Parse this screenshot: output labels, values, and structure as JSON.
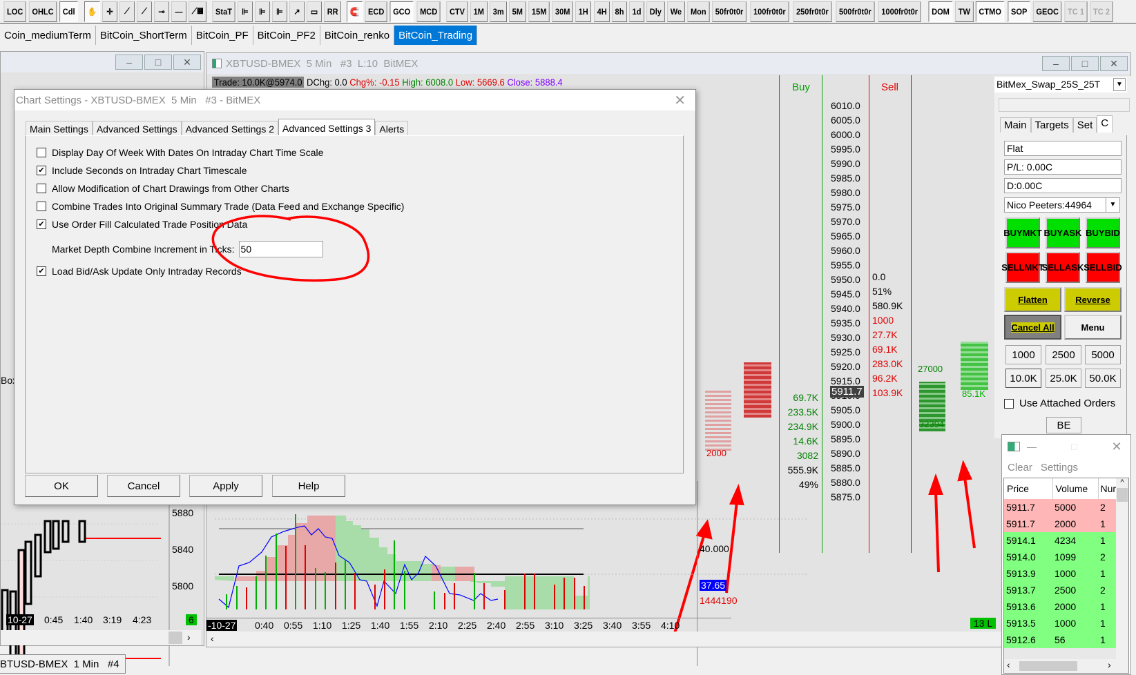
{
  "toolbar": {
    "buttons": [
      "LOC",
      "OHLC",
      "Cdl",
      "hand-tool",
      "crosshair",
      "line",
      "ray",
      "horizontal-ray",
      "horizontal-line",
      "calculator-line",
      "StaT",
      "fib-retracement",
      "fib-extension",
      "fib-time",
      "arrow",
      "rectangle",
      "RR",
      "magnet",
      "ECD",
      "GCO",
      "MCD",
      "CTV",
      "1M",
      "3m",
      "5M",
      "15M",
      "30M",
      "1H",
      "4H",
      "8h",
      "1d",
      "Dly",
      "We",
      "Mon",
      "50fr0t0r",
      "100fr0t0r",
      "250fr0t0r",
      "500fr0t0r",
      "1000fr0t0r",
      "DOM",
      "TW",
      "CTMO",
      "SOP",
      "GEOC",
      "TC 1",
      "TC 2"
    ]
  },
  "chartbook_tabs": [
    "Coin_mediumTerm",
    "BitCoin_ShortTerm",
    "BitCoin_PF",
    "BitCoin_PF2",
    "BitCoin_renko",
    "BitCoin_Trading"
  ],
  "main_chart": {
    "title": "XBTUSD-BMEX  5 Min   #3  L:10  BitMEX",
    "trade": "Trade: 10.0K@5974.0",
    "dchg": "DChg: 0.0",
    "chg": "Chg%: -0.15",
    "high": "High: 6008.0",
    "low": "Low: 5669.6",
    "close": "Close: 5888.4",
    "buy_header": "Buy",
    "sell_header": "Sell",
    "prices": [
      "6010.0",
      "6005.0",
      "6000.0",
      "5995.0",
      "5990.0",
      "5985.0",
      "5980.0",
      "5975.0",
      "5970.0",
      "5965.0",
      "5960.0",
      "5955.0",
      "5950.0",
      "5945.0",
      "5940.0",
      "5935.0",
      "5930.0",
      "5925.0",
      "5920.0",
      "5915.0",
      "5910.0",
      "5905.0",
      "5900.0",
      "5895.0",
      "5890.0",
      "5885.0",
      "5880.0",
      "5875.0"
    ],
    "current_price": "5911.7",
    "sell_stats": [
      {
        "text": "0.0",
        "color": "#000000"
      },
      {
        "text": "51%",
        "color": "#000000"
      },
      {
        "text": "580.9K",
        "color": "#000000"
      },
      {
        "text": "1000",
        "color": "#e00000"
      },
      {
        "text": "27.7K",
        "color": "#e00000"
      },
      {
        "text": "69.1K",
        "color": "#e00000"
      },
      {
        "text": "283.0K",
        "color": "#e00000"
      },
      {
        "text": "96.2K",
        "color": "#e00000"
      },
      {
        "text": "103.9K",
        "color": "#e00000"
      }
    ],
    "buy_stats": [
      {
        "text": "69.7K",
        "color": "#008000"
      },
      {
        "text": "233.5K",
        "color": "#008000"
      },
      {
        "text": "234.9K",
        "color": "#008000"
      },
      {
        "text": "14.6K",
        "color": "#008000"
      },
      {
        "text": "3082",
        "color": "#008000"
      },
      {
        "text": "555.9K",
        "color": "#000000"
      },
      {
        "text": "49%",
        "color": "#000000"
      }
    ],
    "cluster_labels": {
      "red_bottom": "2000",
      "green_bottom": "32394",
      "green_left_top": "27000",
      "green_right_bottom": "85.1K"
    },
    "indicator_axis": "40.000",
    "indicator_value": "37.65",
    "volume_value": "1444190",
    "time_labels": [
      "-10-27",
      "0:40",
      "0:55",
      "1:10",
      "1:25",
      "1:40",
      "1:55",
      "2:10",
      "2:25",
      "2:40",
      "2:55",
      "3:10",
      "3:25",
      "3:40",
      "3:55",
      "4:10"
    ],
    "status_badge": "13 L"
  },
  "left_chart": {
    "price_labels": [
      "5880",
      "5840",
      "5800"
    ],
    "time_labels": [
      "10-27",
      "0:45",
      "1:40",
      "3:19",
      "4:23"
    ],
    "badge": "6",
    "partial_label": "Box"
  },
  "bottom_tab": "BTUSD-BMEX  1 Min   #4",
  "trade_panel": {
    "trade_account": "BitMex_Swap_25S_25T",
    "tabs": [
      "Main",
      "Targets",
      "Set",
      "C"
    ],
    "position": "Flat",
    "pl": "P/L: 0.00C",
    "daily": "D:0.00C",
    "account": "Nico Peeters:44964",
    "buy_buttons": [
      [
        "BUY",
        "MKT"
      ],
      [
        "BUY",
        "ASK"
      ],
      [
        "BUY",
        "BID"
      ]
    ],
    "sell_buttons": [
      [
        "SELL",
        "MKT"
      ],
      [
        "SELL",
        "ASK"
      ],
      [
        "SELL",
        "BID"
      ]
    ],
    "flatten": "Flatten",
    "reverse": "Reverse",
    "cancel_all": "Cancel All",
    "menu": "Menu",
    "quantities": [
      "1000",
      "2500",
      "5000",
      "10.0K",
      "25.0K",
      "50.0K"
    ],
    "use_attached_orders": "Use Attached Orders",
    "be": "BE"
  },
  "time_sales": {
    "menu": [
      "Clear",
      "Settings"
    ],
    "columns": [
      "Price",
      "Volume",
      "Num"
    ],
    "rows": [
      {
        "price": "5911.7",
        "volume": "5000",
        "num": "2",
        "side": "sell"
      },
      {
        "price": "5911.7",
        "volume": "2000",
        "num": "1",
        "side": "sell"
      },
      {
        "price": "5914.1",
        "volume": "4234",
        "num": "1",
        "side": "buy"
      },
      {
        "price": "5914.0",
        "volume": "1099",
        "num": "2",
        "side": "buy"
      },
      {
        "price": "5913.9",
        "volume": "1000",
        "num": "1",
        "side": "buy"
      },
      {
        "price": "5913.7",
        "volume": "2500",
        "num": "2",
        "side": "buy"
      },
      {
        "price": "5913.6",
        "volume": "2000",
        "num": "1",
        "side": "buy"
      },
      {
        "price": "5913.5",
        "volume": "1000",
        "num": "1",
        "side": "buy"
      },
      {
        "price": "5912.6",
        "volume": "56",
        "num": "1",
        "side": "buy"
      }
    ],
    "colors": {
      "sell": "#ffb6b6",
      "buy": "#80ff80"
    }
  },
  "dialog": {
    "title": "Chart Settings - XBTUSD-BMEX  5 Min   #3 - BitMEX",
    "tabs": [
      "Main Settings",
      "Advanced Settings",
      "Advanced Settings 2",
      "Advanced Settings 3",
      "Alerts"
    ],
    "active_tab": 3,
    "options": [
      {
        "label": "Display Day Of Week With Dates On Intraday Chart Time Scale",
        "checked": false
      },
      {
        "label": "Include Seconds on Intraday Chart Timescale",
        "checked": true
      },
      {
        "label": "Allow Modification of Chart Drawings from Other Charts",
        "checked": false
      },
      {
        "label": "Combine Trades Into Original Summary Trade (Data Feed and Exchange Specific)",
        "checked": false
      },
      {
        "label": "Use Order Fill Calculated Trade Position Data",
        "checked": true
      }
    ],
    "increment_label": "Market Depth Combine Increment in Ticks:",
    "increment_value": "50",
    "load_bid_ask": {
      "label": "Load Bid/Ask Update Only Intraday Records",
      "checked": true
    },
    "buttons": {
      "ok": "OK",
      "cancel": "Cancel",
      "apply": "Apply",
      "help": "Help"
    }
  }
}
